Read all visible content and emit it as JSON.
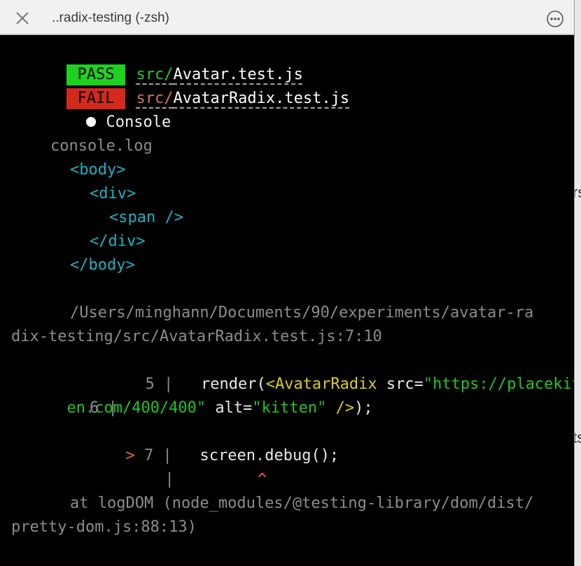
{
  "window": {
    "title": "..radix-testing (-zsh)"
  },
  "icons": {
    "close": "close-icon",
    "more": "more-options-icon"
  },
  "results": [
    {
      "status": "PASS",
      "dir": "src/",
      "file": "Avatar.test.js"
    },
    {
      "status": "FAIL",
      "dir": "src/",
      "file": "AvatarRadix.test.js"
    }
  ],
  "console_header": "Console",
  "log_label": "console.log",
  "dom_lines": [
    "<body>",
    "<div>",
    "<span />",
    "</div>",
    "</body>"
  ],
  "trace": {
    "path_line1": "/Users/minghann/Documents/90/experiments/avatar-ra",
    "path_line2": "dix-testing/src/AvatarRadix.test.js:7:10",
    "code": {
      "line5_num": "5 |",
      "line5_fn": "render(",
      "line5_tag": "<AvatarRadix",
      "line5_attr1": " src=",
      "line5_val1a": "\"https://placekitt",
      "line5_val1b": "en.com/400/400\"",
      "line5_attr2": " alt=",
      "line5_val2": "\"kitten\"",
      "line5_close": " />",
      "line5_end": ");",
      "line6_num": "6 |",
      "line7_marker": ">",
      "line7_num": "7 |",
      "line7_obj": "screen",
      "line7_dot": ".",
      "line7_fn": "debug();",
      "caret_bar": "|",
      "caret": "^"
    },
    "at_line1": "at logDOM (node_modules/@testing-library/dom/dist/",
    "at_line2": "pretty-dom.js:88:13)"
  },
  "background_window": {
    "fragment_a": "rs",
    "fragment_b": "ts"
  },
  "colors": {
    "pass_bg": "#1fd11f",
    "fail_bg": "#d42a1c",
    "tag_cyan": "#22b0c0",
    "string_green": "#22c522",
    "jsx_yellow": "#d9cc22",
    "marker_red": "#f06060"
  }
}
